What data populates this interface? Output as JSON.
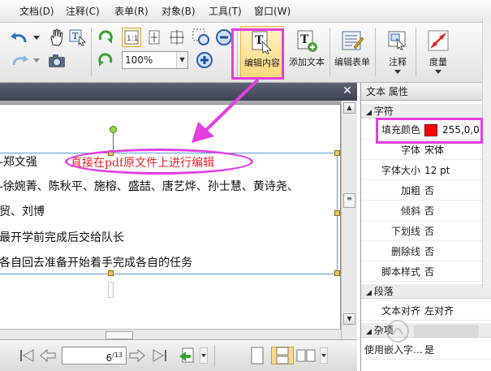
{
  "menubar": {
    "items": [
      "文档(D)",
      "注释(C)",
      "表单(R)",
      "对象(B)",
      "工具(T)",
      "窗口(W)"
    ]
  },
  "toolbar": {
    "zoom_value": "100%",
    "edit_content_label": "编辑内容",
    "add_text_label": "添加文本",
    "edit_form_label": "编辑表单",
    "annotate_label": "注释",
    "measure_label": "度量"
  },
  "document": {
    "lines": [
      "-郑文强",
      "-徐婉菁、陈秋平、施榕、盛喆、唐艺烨、孙士慧、黄诗尧、",
      "贸、刘博",
      "最开学前完成后交给队长",
      "各自回去准备开始着手完成各自的任务"
    ],
    "edited_text": "直接在pdf原文件上进行编辑"
  },
  "pagenav": {
    "current_page": "6",
    "total_pages": "13"
  },
  "properties": {
    "title": "文本 属性",
    "groups": {
      "character": "字符",
      "paragraph": "段落",
      "misc": "杂项"
    },
    "rows": [
      {
        "key": "填充颜色",
        "value": "255,0,0"
      },
      {
        "key": "字体",
        "value": "宋体"
      },
      {
        "key": "字体大小",
        "value": "12 pt"
      },
      {
        "key": "加粗",
        "value": "否"
      },
      {
        "key": "倾斜",
        "value": "否"
      },
      {
        "key": "下划线",
        "value": "否"
      },
      {
        "key": "删除线",
        "value": "否"
      },
      {
        "key": "脚本样式",
        "value": "否"
      }
    ],
    "paragraph_rows": [
      {
        "key": "文本对齐",
        "value": "左对齐"
      }
    ],
    "misc_rows": [
      {
        "key": "使用嵌入字...",
        "value": "是"
      }
    ],
    "fill_color": "#ff0000"
  },
  "colors": {
    "highlight": "#e43fe0",
    "edited_text": "#e3262b"
  }
}
